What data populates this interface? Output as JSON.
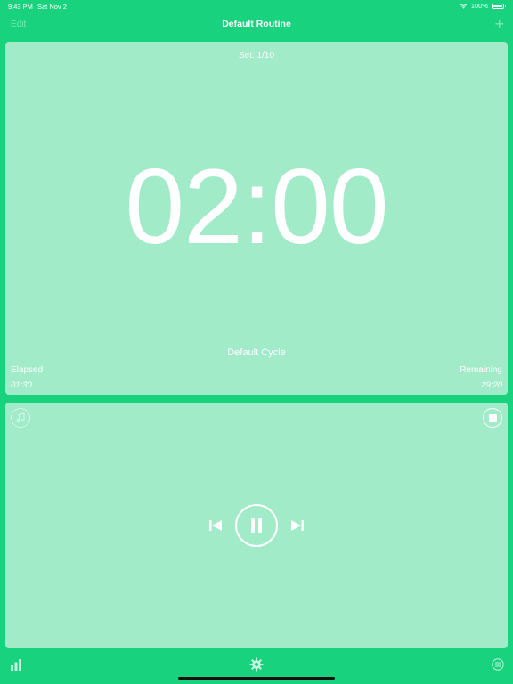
{
  "status_bar": {
    "time": "9:43 PM",
    "date": "Sat Nov 2",
    "battery": "100%"
  },
  "nav": {
    "edit_label": "Edit",
    "title": "Default Routine",
    "add_label": "+"
  },
  "timer": {
    "set_label": "Set: 1/10",
    "display": "02:00",
    "cycle_name": "Default Cycle",
    "elapsed_label": "Elapsed",
    "elapsed_value": "01:30",
    "remaining_label": "Remaining",
    "remaining_value": "29:20"
  },
  "player": {
    "music_icon": "music-note-icon",
    "stop_icon": "stop-icon",
    "prev_icon": "skip-back-icon",
    "pause_icon": "pause-icon",
    "next_icon": "skip-forward-icon"
  },
  "tab_bar": {
    "stats_icon": "bar-chart-icon",
    "settings_icon": "gear-icon",
    "list_icon": "list-icon"
  },
  "colors": {
    "background": "#19d27d",
    "panel": "#a1ebc9",
    "text": "#ffffff"
  }
}
